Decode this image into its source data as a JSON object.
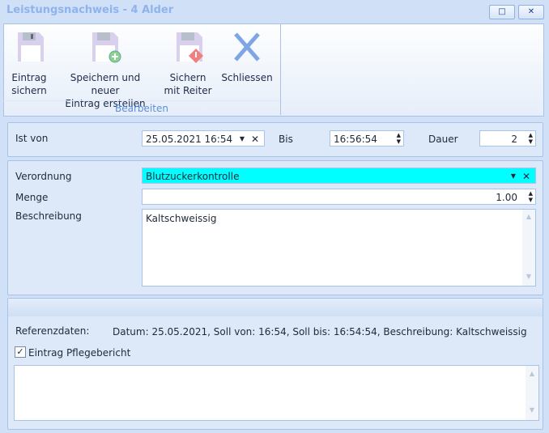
{
  "window": {
    "title": "Leistungsnachweis - 4 Alder",
    "maximize": "□",
    "close": "✕"
  },
  "ribbon": {
    "buttons": [
      {
        "line1": "Eintrag",
        "line2": "sichern"
      },
      {
        "line1": "Speichern und neuer",
        "line2": "Eintrag erstellen"
      },
      {
        "line1": "Sichern",
        "line2": "mit Reiter"
      },
      {
        "line1": "Schliessen",
        "line2": ""
      }
    ],
    "group": "Bearbeiten"
  },
  "time": {
    "ist_von_label": "Ist von",
    "ist_von": "25.05.2021 16:54",
    "bis_label": "Bis",
    "bis": "16:56:54",
    "dauer_label": "Dauer",
    "dauer": "2"
  },
  "entry": {
    "verordnung_label": "Verordnung",
    "verordnung": "Blutzuckerkontrolle",
    "menge_label": "Menge",
    "menge": "1.00",
    "beschreibung_label": "Beschreibung",
    "beschreibung": "Kaltschweissig"
  },
  "ref": {
    "label": "Referenzdaten:",
    "text": "Datum: 25.05.2021, Soll von: 16:54, Soll bis: 16:54:54, Beschreibung: Kaltschweissig",
    "checkbox_label": "Eintrag Pflegebericht",
    "checked": true,
    "notes": ""
  },
  "colors": {
    "highlight": "#00ffff"
  }
}
